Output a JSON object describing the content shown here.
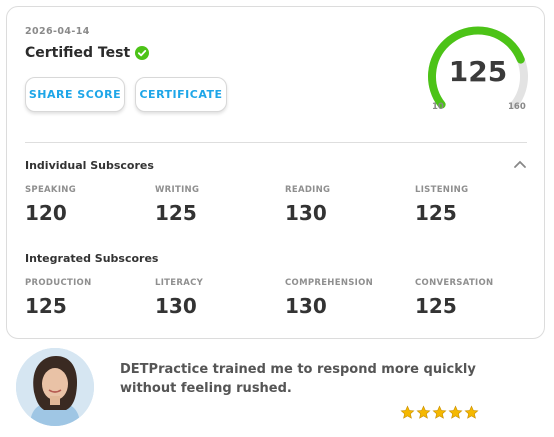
{
  "score_card": {
    "date": "2026-04-14",
    "title": "Certified Test",
    "share_label": "SHARE SCORE",
    "certificate_label": "CERTIFICATE",
    "overall_score": "125",
    "gauge_min": "10",
    "gauge_max": "160",
    "gauge_fill_fraction": 0.767,
    "accent_color": "#4cc317",
    "button_text_color": "#1ea6e8"
  },
  "individual": {
    "title": "Individual Subscores",
    "items": [
      {
        "label": "SPEAKING",
        "value": "120"
      },
      {
        "label": "WRITING",
        "value": "125"
      },
      {
        "label": "READING",
        "value": "130"
      },
      {
        "label": "LISTENING",
        "value": "125"
      }
    ]
  },
  "integrated": {
    "title": "Integrated Subscores",
    "items": [
      {
        "label": "PRODUCTION",
        "value": "125"
      },
      {
        "label": "LITERACY",
        "value": "130"
      },
      {
        "label": "COMPREHENSION",
        "value": "130"
      },
      {
        "label": "CONVERSATION",
        "value": "125"
      }
    ]
  },
  "review": {
    "text": "DETPractice trained me to respond more quickly without feeling rushed.",
    "rating": 5,
    "star_color": "#f5b800"
  }
}
